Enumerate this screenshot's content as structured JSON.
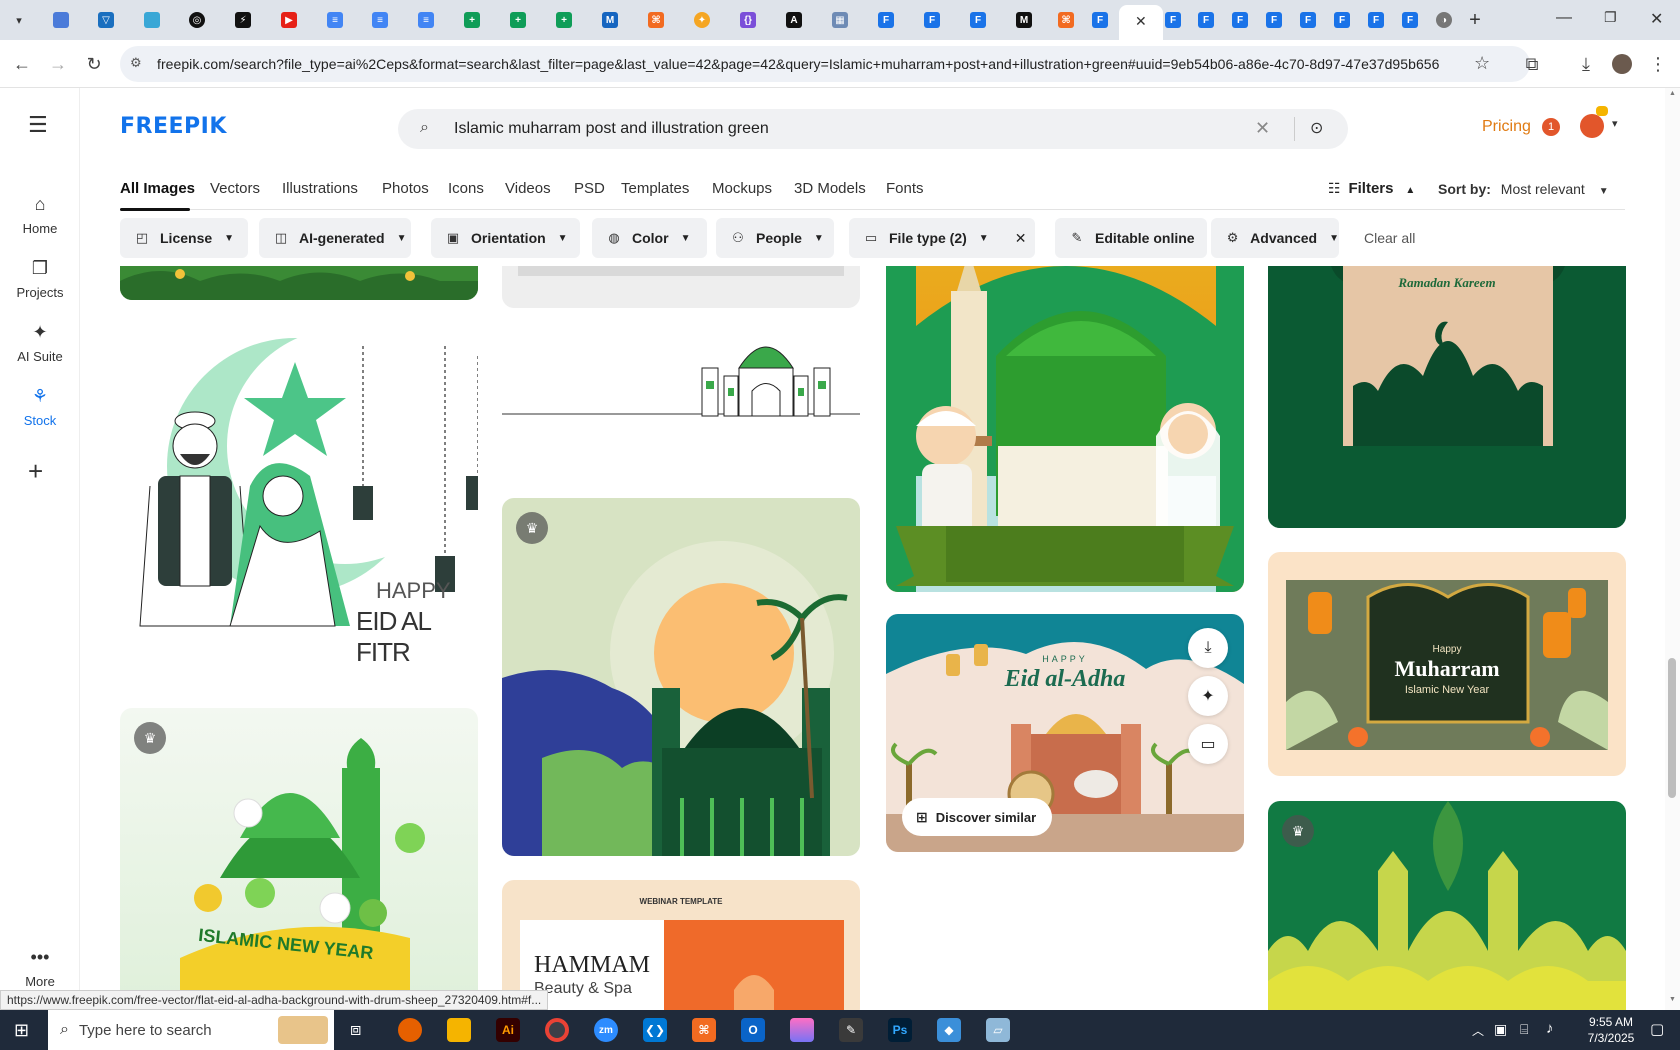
{
  "browser": {
    "url": "freepik.com/search?file_type=ai%2Ceps&format=search&last_filter=page&last_value=42&page=42&query=Islamic+muharram+post+and+illustration+green#uuid=9eb54b06-a86e-4c70-8d97-47e37d95b656",
    "status_url": "https://www.freepik.com/free-vector/flat-eid-al-adha-background-with-drum-sheep_27320409.htm#f..."
  },
  "rail": [
    {
      "label": "Home",
      "icon": "home-icon"
    },
    {
      "label": "Projects",
      "icon": "projects-icon"
    },
    {
      "label": "AI Suite",
      "icon": "sparkle-icon"
    },
    {
      "label": "Stock",
      "icon": "stock-icon"
    },
    {
      "label": "More",
      "icon": "more-icon"
    }
  ],
  "header": {
    "logo": "FREEPIK",
    "search_value": "Islamic muharram post and illustration green",
    "pricing": "Pricing",
    "notif_count": "1"
  },
  "categories": [
    "All Images",
    "Vectors",
    "Illustrations",
    "Photos",
    "Icons",
    "Videos",
    "PSD",
    "Templates",
    "Mockups",
    "3D Models",
    "Fonts"
  ],
  "filters_label": "Filters",
  "sort": {
    "label": "Sort by:",
    "value": "Most relevant"
  },
  "filter_buttons": [
    "License",
    "AI-generated",
    "Orientation",
    "Color",
    "People",
    "File type (2)",
    "Editable online",
    "Advanced"
  ],
  "clear_all": "Clear all",
  "cards": {
    "eid_fitr": {
      "line1": "HAPPY",
      "line2": "EID AL FITR"
    },
    "new_year": "ISLAMIC NEW YEAR",
    "ramadan": "Ramadan Kareem",
    "eid_adha": {
      "small": "HAPPY",
      "title": "Eid al-Adha"
    },
    "muharram": {
      "small": "Happy",
      "title": "Muharram",
      "sub": "Islamic New Year"
    },
    "webinar": {
      "tag": "WEBINAR TEMPLATE",
      "title": "HAMMAM",
      "sub": "Beauty & Spa"
    },
    "discover": "Discover similar"
  },
  "taskbar": {
    "search_placeholder": "Type here to search",
    "time": "9:55 AM",
    "date": "7/3/2025"
  },
  "colors": {
    "brand": "#1273eb",
    "pricing": "#e07b13",
    "taskbar": "#1f2a3a",
    "tabbar": "#dee3ea"
  }
}
